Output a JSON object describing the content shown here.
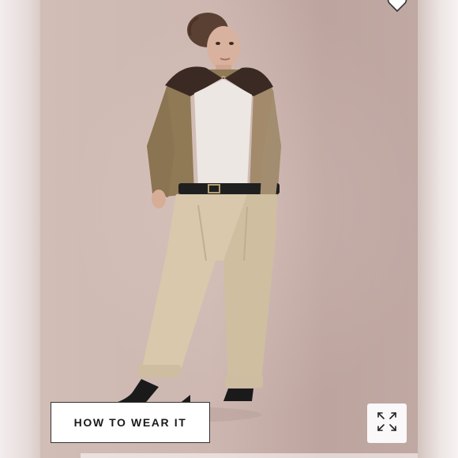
{
  "product_image": {
    "alt_subject": "model-in-tan-jacket-and-khaki-trousers"
  },
  "actions": {
    "how_to_wear_label": "HOW TO WEAR IT",
    "wishlist_icon": "heart-outline-icon",
    "expand_icon": "expand-arrows-icon"
  },
  "colors": {
    "background": "#cdbab4",
    "button_bg": "#ffffff",
    "button_text": "#1a1a1a"
  }
}
